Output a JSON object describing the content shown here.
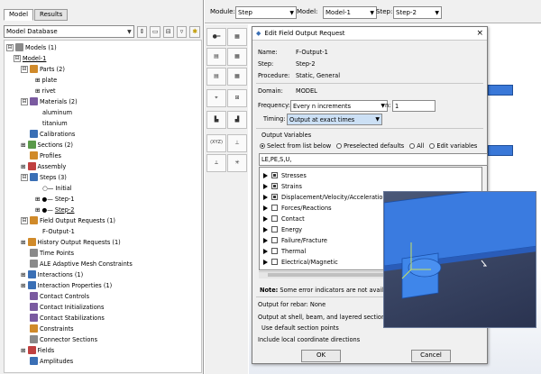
{
  "left_panel": {
    "tabs": [
      {
        "label": "Model"
      },
      {
        "label": "Results"
      }
    ],
    "database_selector": {
      "value": "Model Database"
    },
    "tree": [
      {
        "label": "Models (1)",
        "expander": "⊟"
      },
      {
        "label": "Model-1",
        "expander": "⊟"
      },
      {
        "label": "Parts (2)",
        "expander": "⊟"
      },
      {
        "label": "plate",
        "expander": "⊞"
      },
      {
        "label": "rivet",
        "expander": "⊞"
      },
      {
        "label": "Materials (2)",
        "expander": "⊟"
      },
      {
        "label": "aluminum",
        "expander": ""
      },
      {
        "label": "titanium",
        "expander": ""
      },
      {
        "label": "Calibrations",
        "expander": ""
      },
      {
        "label": "Sections (2)",
        "expander": "⊞"
      },
      {
        "label": "Profiles",
        "expander": ""
      },
      {
        "label": "Assembly",
        "expander": "⊞"
      },
      {
        "label": "Steps (3)",
        "expander": "⊟"
      },
      {
        "label": "Initial",
        "expander": ""
      },
      {
        "label": "Step-1",
        "expander": "⊞"
      },
      {
        "label": "Step-2",
        "expander": "⊞"
      },
      {
        "label": "Field Output Requests (1)",
        "expander": "⊟"
      },
      {
        "label": "F-Output-1",
        "expander": ""
      },
      {
        "label": "History Output Requests (1)",
        "expander": "⊞"
      },
      {
        "label": "Time Points",
        "expander": ""
      },
      {
        "label": "ALE Adaptive Mesh Constraints",
        "expander": ""
      },
      {
        "label": "Interactions (1)",
        "expander": "⊞"
      },
      {
        "label": "Interaction Properties (1)",
        "expander": "⊞"
      },
      {
        "label": "Contact Controls",
        "expander": ""
      },
      {
        "label": "Contact Initializations",
        "expander": ""
      },
      {
        "label": "Contact Stabilizations",
        "expander": ""
      },
      {
        "label": "Constraints",
        "expander": ""
      },
      {
        "label": "Connector Sections",
        "expander": ""
      },
      {
        "label": "Fields",
        "expander": "⊞"
      },
      {
        "label": "Amplitudes",
        "expander": ""
      }
    ]
  },
  "context_bar": {
    "module_label": "Module:",
    "module_value": "Step",
    "model_label": "Model:",
    "model_value": "Model-1",
    "step_label": "Step:",
    "step_value": "Step-2"
  },
  "toolbox": {
    "coord_label": "(XYZ)"
  },
  "dialog": {
    "title": "Edit Field Output Request",
    "name_label": "Name:",
    "name_value": "F-Output-1",
    "step_label": "Step:",
    "step_value": "Step-2",
    "procedure_label": "Procedure:",
    "procedure_value": "Static, General",
    "domain_label": "Domain:",
    "domain_value": "MODEL",
    "frequency_label": "Frequency:",
    "frequency_value": "Every n increments",
    "n_label": "n:",
    "n_value": "1",
    "timing_label": "Timing:",
    "timing_value": "Output at exact times",
    "output_variables_label": "Output Variables",
    "radios": [
      {
        "label": "Select from list below",
        "selected": true
      },
      {
        "label": "Preselected defaults",
        "selected": false
      },
      {
        "label": "All",
        "selected": false
      },
      {
        "label": "Edit variables",
        "selected": false
      }
    ],
    "variables_text": "LE,PE,S,U,",
    "variable_groups": [
      {
        "label": "Stresses",
        "partial": true
      },
      {
        "label": "Strains",
        "partial": true
      },
      {
        "label": "Displacement/Velocity/Acceleration",
        "partial": true
      },
      {
        "label": "Forces/Reactions",
        "partial": false
      },
      {
        "label": "Contact",
        "partial": false
      },
      {
        "label": "Energy",
        "partial": false
      },
      {
        "label": "Failure/Fracture",
        "partial": false
      },
      {
        "label": "Thermal",
        "partial": false
      },
      {
        "label": "Electrical/Magnetic",
        "partial": false
      }
    ],
    "note_label": "Note:",
    "note_text": "Some error indicators are not available",
    "rebar_text": "Output for rebar:  None",
    "shell_text": "Output at shell, beam, and layered section poin",
    "default_points_text": "Use default section points",
    "local_coords_text": "Include local coordinate directions",
    "ok_label": "OK",
    "cancel_label": "Cancel"
  }
}
